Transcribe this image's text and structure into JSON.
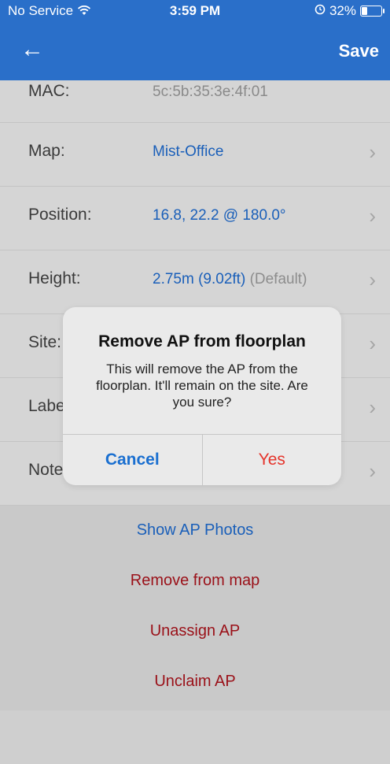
{
  "status_bar": {
    "carrier": "No Service",
    "time": "3:59 PM",
    "battery": "32%"
  },
  "navbar": {
    "back_icon": "←",
    "save_label": "Save"
  },
  "rows": [
    {
      "label": "MAC:",
      "value": "5c:5b:35:3e:4f:01"
    },
    {
      "label": "Map:",
      "value": "Mist-Office"
    },
    {
      "label": "Position:",
      "value": "16.8, 22.2 @ 180.0°"
    },
    {
      "label": "Height:",
      "value": "2.75m (9.02ft)",
      "suffix": "(Default)"
    },
    {
      "label": "Site:",
      "value": ""
    },
    {
      "label": "Labe",
      "value": ""
    },
    {
      "label": "Notes:",
      "value": ""
    }
  ],
  "actions": {
    "show_photos": "Show AP Photos",
    "remove_from_map": "Remove from map",
    "unassign": "Unassign AP",
    "unclaim": "Unclaim AP"
  },
  "dialog": {
    "title": "Remove AP from floorplan",
    "message": "This will remove the AP from the floorplan. It'll remain on the site. Are you sure?",
    "cancel_label": "Cancel",
    "yes_label": "Yes"
  },
  "icons": {
    "chevron": "›",
    "wifi": "wifi-icon",
    "alarm": "alarm-icon"
  },
  "colors": {
    "brand": "#2a6fc9",
    "link": "#1a5fb9",
    "destructive": "#9a1018",
    "alert_yes": "#e5332a"
  }
}
